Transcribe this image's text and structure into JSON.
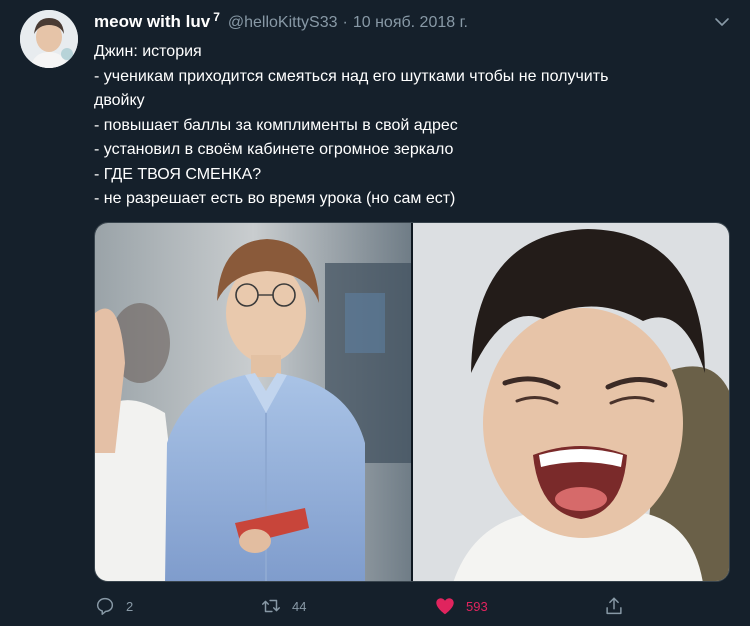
{
  "tweet": {
    "display_name": "meow with luv",
    "badge": "7",
    "handle": "@helloKittyS33",
    "separator": "·",
    "date": "10 нояб. 2018 г.",
    "lines": [
      "Джин: история",
      "- ученикам приходится смеяться над его шутками чтобы не получить",
      "двойку",
      "- повышает баллы за комплименты в свой адрес",
      "- установил в своём кабинете огромное зеркало",
      "- ГДЕ ТВОЯ СМЕНКА?",
      "- не разрешает есть во время урока (но сам ест)"
    ]
  },
  "actions": {
    "reply_count": "2",
    "retweet_count": "44",
    "like_count": "593"
  },
  "colors": {
    "background": "#15202b",
    "text": "#ffffff",
    "secondary": "#8899a6",
    "like": "#e0245e",
    "border": "#38444d"
  },
  "icons": [
    "reply-icon",
    "retweet-icon",
    "heart-icon",
    "share-icon",
    "chevron-down-icon"
  ]
}
